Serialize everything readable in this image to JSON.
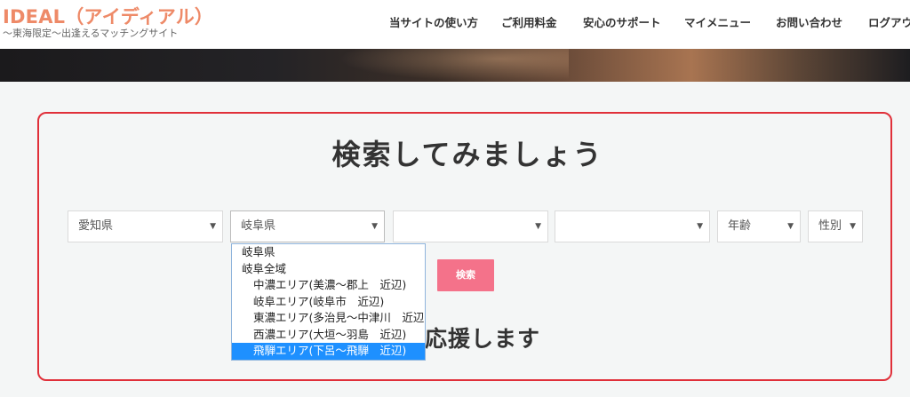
{
  "header": {
    "logo": "IDEAL（アイディアル）",
    "tagline": "〜東海限定〜出逢えるマッチングサイト",
    "nav": [
      "当サイトの使い方",
      "ご利用料金",
      "安心のサポート",
      "マイメニュー",
      "お問い合わせ",
      "ログアウト"
    ]
  },
  "search": {
    "title": "検索してみましょう",
    "selects": {
      "prefecture": "愛知県",
      "area": "岐阜県",
      "city": "",
      "town": "",
      "age": "年齢",
      "sex": "性別"
    },
    "button": "検索",
    "subtitle": "なたを応援します"
  },
  "dropdown": {
    "options": [
      {
        "label": "岐阜県",
        "indent": false,
        "selected": false
      },
      {
        "label": "岐阜全域",
        "indent": false,
        "selected": false
      },
      {
        "label": "中濃エリア(美濃〜郡上　近辺)",
        "indent": true,
        "selected": false
      },
      {
        "label": "岐阜エリア(岐阜市　近辺)",
        "indent": true,
        "selected": false
      },
      {
        "label": "東濃エリア(多治見〜中津川　近辺)",
        "indent": true,
        "selected": false
      },
      {
        "label": "西濃エリア(大垣〜羽島　近辺)",
        "indent": true,
        "selected": false
      },
      {
        "label": "飛騨エリア(下呂〜飛騨　近辺)",
        "indent": true,
        "selected": true
      }
    ]
  },
  "icons": {
    "select_arrow": "▼"
  }
}
